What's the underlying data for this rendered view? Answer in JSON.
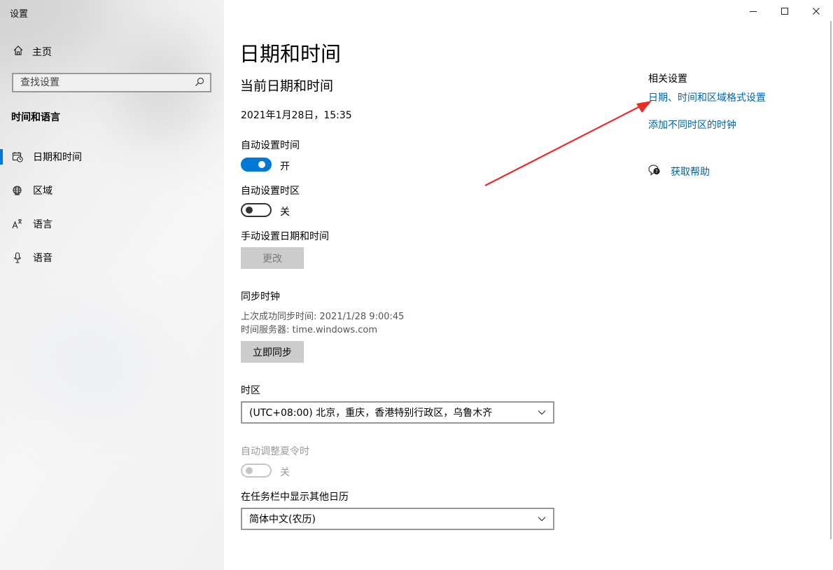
{
  "window": {
    "title": "设置"
  },
  "sidebar": {
    "home_label": "主页",
    "search_placeholder": "查找设置",
    "section_title": "时间和语言",
    "items": [
      {
        "label": "日期和时间",
        "icon": "calendar-clock-icon",
        "active": true
      },
      {
        "label": "区域",
        "icon": "globe-icon"
      },
      {
        "label": "语言",
        "icon": "language-icon"
      },
      {
        "label": "语音",
        "icon": "microphone-icon"
      }
    ]
  },
  "main": {
    "page_title": "日期和时间",
    "current_heading": "当前日期和时间",
    "current_datetime": "2021年1月28日，15:35",
    "auto_time": {
      "label": "自动设置时间",
      "state_text": "开",
      "on": true
    },
    "auto_timezone": {
      "label": "自动设置时区",
      "state_text": "关",
      "on": false
    },
    "manual": {
      "label": "手动设置日期和时间",
      "button": "更改"
    },
    "sync": {
      "heading": "同步时钟",
      "last_sync": "上次成功同步时间: 2021/1/28 9:00:45",
      "server": "时间服务器: time.windows.com",
      "button": "立即同步"
    },
    "timezone": {
      "label": "时区",
      "value": "(UTC+08:00) 北京，重庆，香港特别行政区，乌鲁木齐"
    },
    "dst": {
      "label": "自动调整夏令时",
      "state_text": "关",
      "disabled": true
    },
    "calendar": {
      "label": "在任务栏中显示其他日历",
      "value": "简体中文(农历)"
    }
  },
  "related": {
    "heading": "相关设置",
    "links": [
      "日期、时间和区域格式设置",
      "添加不同时区的时钟"
    ],
    "help_label": "获取帮助"
  },
  "colors": {
    "accent": "#0078d7",
    "link": "#0063b1",
    "annotation_arrow": "#ee2a24"
  }
}
